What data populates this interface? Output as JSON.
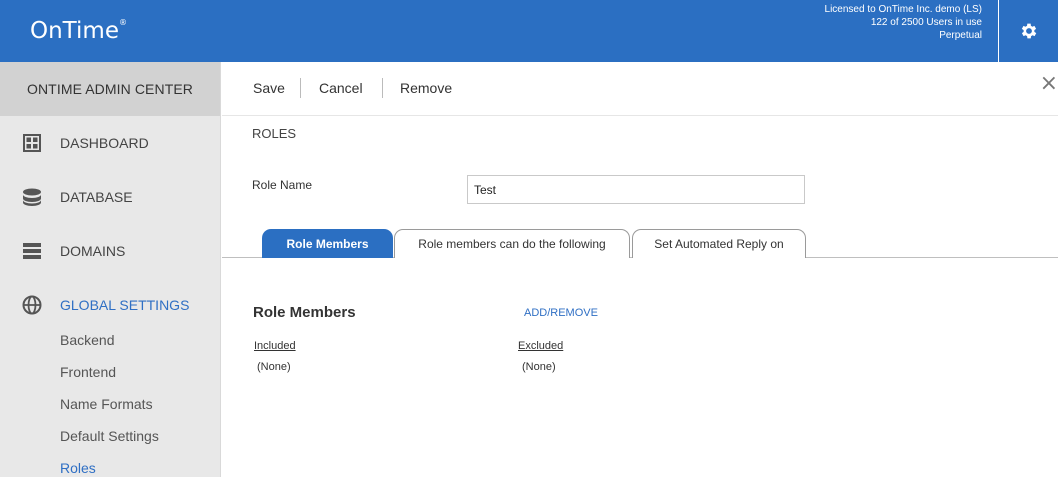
{
  "app": {
    "logo_text": "OnTime",
    "logo_mark": "®",
    "license_line1": "Licensed to OnTime Inc. demo (LS)",
    "license_line2": "122 of 2500 Users in use",
    "license_line3": "Perpetual"
  },
  "sidebar": {
    "header": "ONTIME ADMIN CENTER",
    "items": [
      {
        "label": "DASHBOARD",
        "icon": "dashboard-grid-icon"
      },
      {
        "label": "DATABASE",
        "icon": "database-icon"
      },
      {
        "label": "DOMAINS",
        "icon": "domains-list-icon"
      },
      {
        "label": "GLOBAL SETTINGS",
        "icon": "globe-icon"
      }
    ],
    "subitems": [
      "Backend",
      "Frontend",
      "Name Formats",
      "Default Settings",
      "Roles"
    ],
    "active_subitem": "Roles"
  },
  "toolbar": {
    "save_label": "Save",
    "cancel_label": "Cancel",
    "remove_label": "Remove",
    "close_label": "×"
  },
  "form": {
    "section_title": "ROLES",
    "role_name_label": "Role Name",
    "role_name_value": "Test"
  },
  "tabs": [
    {
      "label": "Role Members",
      "active": true
    },
    {
      "label": "Role members can do the following",
      "active": false
    },
    {
      "label": "Set Automated Reply on",
      "active": false
    }
  ],
  "role_members": {
    "title": "Role Members",
    "add_remove_label": "ADD/REMOVE",
    "included_header": "Included",
    "included_value": "(None)",
    "excluded_header": "Excluded",
    "excluded_value": "(None)"
  },
  "colors": {
    "brand": "#2b6fc2",
    "link": "#2f6fc4",
    "sidebar_bg": "#e8e8e8",
    "sidebar_header_bg": "#d2d2d2"
  }
}
